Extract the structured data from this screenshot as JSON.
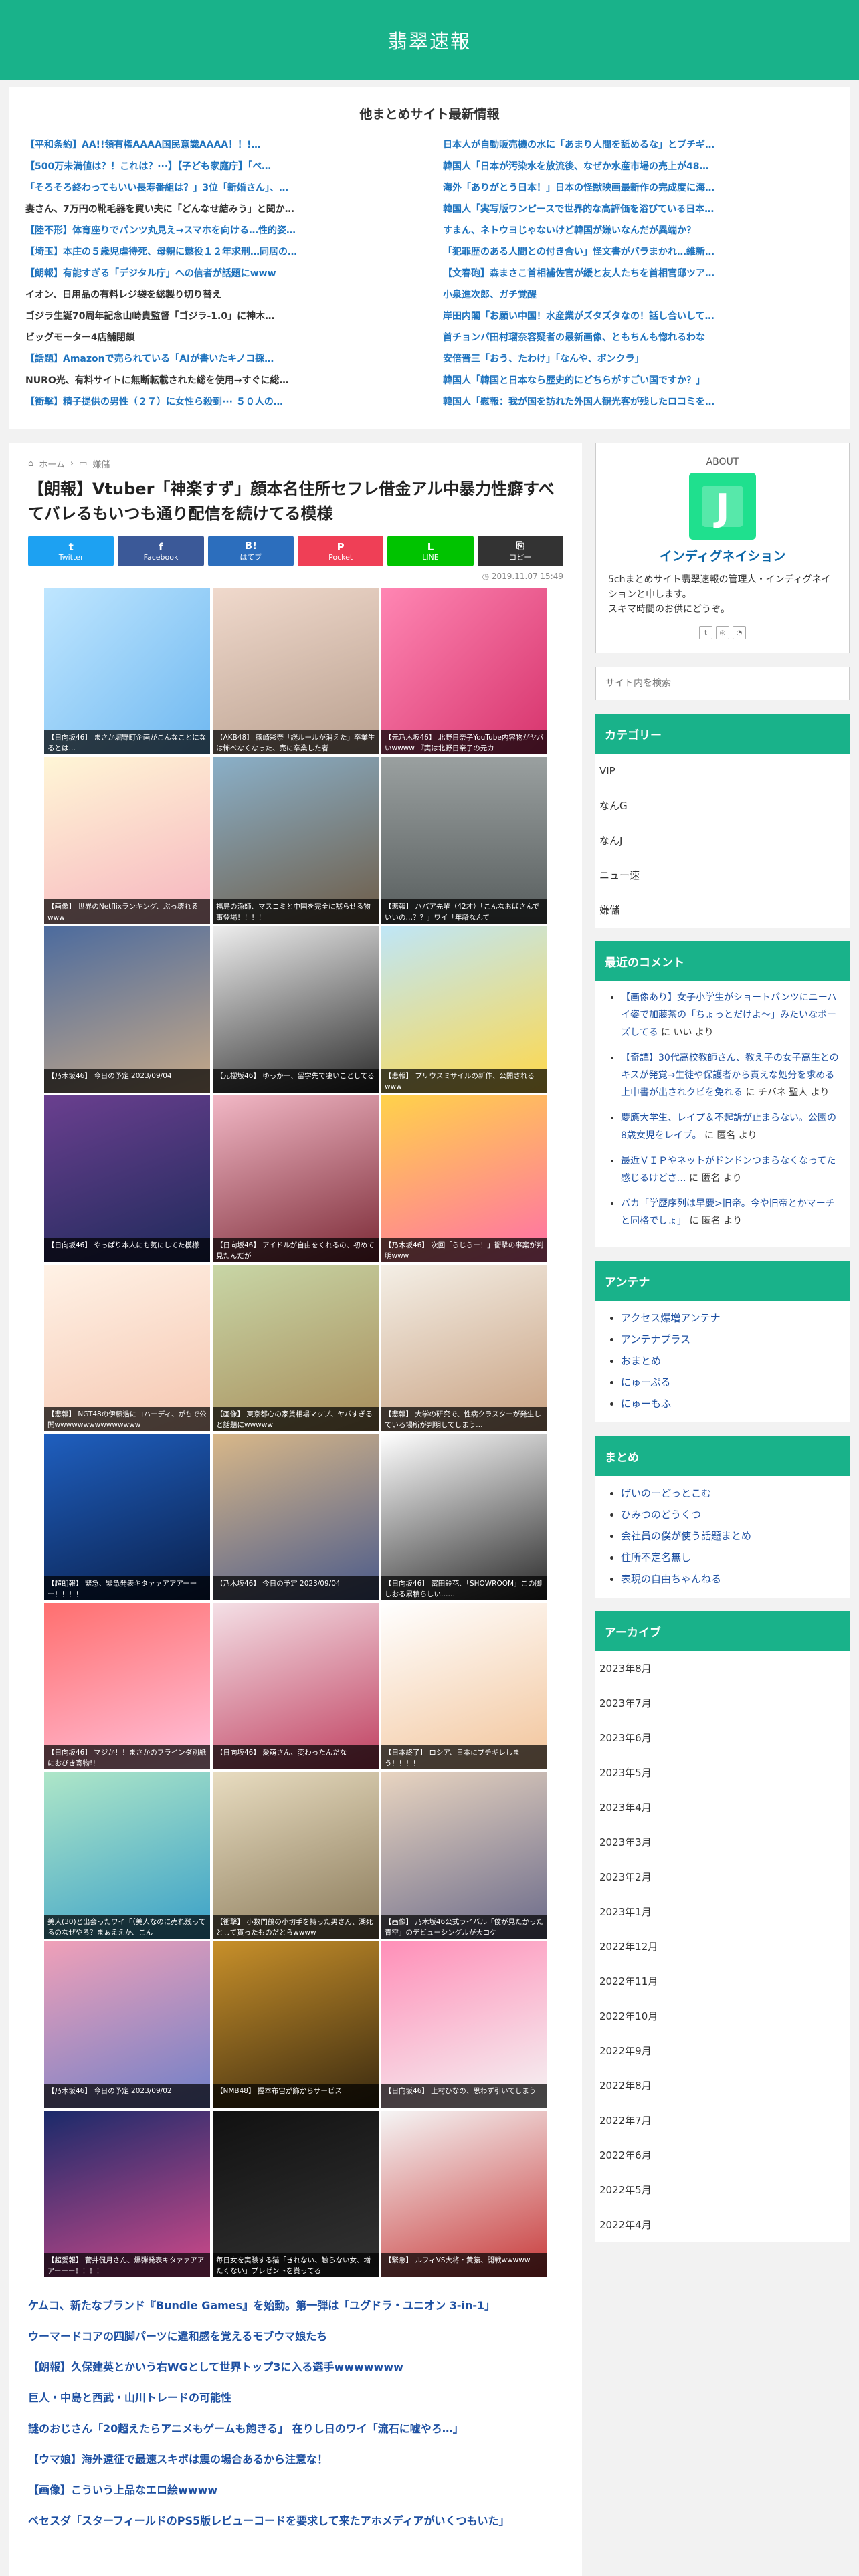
{
  "site": {
    "title": "翡翠速報"
  },
  "other_sites": {
    "title": "他まとめサイト最新情報",
    "left": [
      {
        "text": "【平和条約】AA!!領有権AAAA国民意識AAAA！！!…",
        "color": "#1e73be"
      },
      {
        "text": "【500万未満値は？！これは？···】【子ども家庭庁】「ベ…",
        "color": "#1e73be"
      },
      {
        "text": "「そろそろ終わってもいい長寿番組は？」3位「新婚さん」、…",
        "color": "#1e73be"
      },
      {
        "text": "妻さん、7万円の靴毛器を買い夫に「どんなせ結みう」と聞か…",
        "color": "#333333"
      },
      {
        "text": "【陸不形】体育座りでパンツ丸見え→スマホを向ける…性的姿…",
        "color": "#1e73be"
      },
      {
        "text": "【埼玉】本庄の５歳児虐待死、母親に懲役１２年求刑…同居の…",
        "color": "#1e73be"
      },
      {
        "text": "【朗報】有能すぎる「デジタル庁」への信者が話題にwww",
        "color": "#1e73be"
      },
      {
        "text": "イオン、日用品の有料レジ袋を総製り切り替え",
        "color": "#333333"
      },
      {
        "text": "ゴジラ生誕70周年記念山崎貴監督「ゴジラ-1.0」に神木…",
        "color": "#333333"
      },
      {
        "text": "ビッグモーター4店舗閉鎖",
        "color": "#333333"
      },
      {
        "text": "【話題】Amazonで売られている「AIが書いたキノコ採…",
        "color": "#1e73be"
      },
      {
        "text": "NURO光、有料サイトに無断転載された総を使用→すぐに総…",
        "color": "#333333"
      },
      {
        "text": "【衝撃】精子提供の男性（２７）に女性ら殺到··· ５０人の…",
        "color": "#1e73be"
      }
    ],
    "right": [
      {
        "text": "日本人が自動販売機の水に「あまり人間を舐めるな」とブチギ…",
        "color": "#1e73be"
      },
      {
        "text": "韓国人「日本が汚染水を放流後、なぜか水産市場の売上が48…",
        "color": "#1e73be"
      },
      {
        "text": "海外「ありがとう日本！」日本の怪獣映画最新作の完成度に海…",
        "color": "#1e73be"
      },
      {
        "text": "韓国人「実写版ワンピースで世界的な高評価を浴びている日本…",
        "color": "#1e73be"
      },
      {
        "text": "すまん、ネトウヨじゃないけど韓国が嫌いなんだが異端か？",
        "color": "#1e73be"
      },
      {
        "text": "「犯罪歴のある人間との付き合い」怪文書がバラまかれ…維新…",
        "color": "#1e73be"
      },
      {
        "text": "【文春砲】森まさこ首相補佐官が緩と友人たちを首相官邸ツア…",
        "color": "#1e73be"
      },
      {
        "text": "小泉進次郎、ガチ覚醒",
        "color": "#1e73be"
      },
      {
        "text": "岸田内閣「お願い中国！水産業がズタズタなの！話し合いして…",
        "color": "#1e73be"
      },
      {
        "text": "首チョンパ田村瑠奈容疑者の最新画像、ともちんも惚れるわな",
        "color": "#1e73be"
      },
      {
        "text": "安倍晋三「おう、たわけ」「なんや、ボンクラ」",
        "color": "#1e73be"
      },
      {
        "text": "韓国人「韓国と日本なら歴史的にどちらがすごい国ですか？」",
        "color": "#1e73be"
      },
      {
        "text": "韓国人「慰報：我が国を訪れた外国人観光客が残したロコミを…",
        "color": "#1e73be"
      }
    ]
  },
  "breadcrumb": {
    "home": "ホーム",
    "category": "嫌儲"
  },
  "post": {
    "title": "【朗報】Vtuber「神楽すず」顔本名住所セフレ借金アル中暴力性癖すべてバレるもいつも通り配信を続けてる模様",
    "date": "2019.11.07 15:49"
  },
  "share": [
    {
      "label": "Twitter",
      "icon": "t",
      "color": "#1da1f2"
    },
    {
      "label": "Facebook",
      "icon": "f",
      "color": "#3b5998"
    },
    {
      "label": "はてブ",
      "icon": "B!",
      "color": "#2c6ebd"
    },
    {
      "label": "Pocket",
      "icon": "P",
      "color": "#ef3f56"
    },
    {
      "label": "LINE",
      "icon": "L",
      "color": "#00c300"
    },
    {
      "label": "コピー",
      "icon": "⎘",
      "color": "#333333"
    }
  ],
  "thumbs": [
    {
      "caption": "【日向坂46】 まさか堀野町企画がこんなことになるとは…",
      "bg": "linear-gradient(135deg,#bfe6ff,#6fb8f0)"
    },
    {
      "caption": "【AKB48】 篠崎彩奈「謎ルールが消えた」卒業生は怖べなくなった、売に卒業した者",
      "bg": "linear-gradient(160deg,#f0d9cc,#b9a08f)"
    },
    {
      "caption": "【元乃木坂46】 北野日奈子YouTube内容物がヤバいwwww 『実は北野日奈子の元カ",
      "bg": "linear-gradient(135deg,#ff86b3,#d6336c)"
    },
    {
      "caption": "【画像】 世界のNetflixランキング、ぶっ壊れるwww",
      "bg": "linear-gradient(160deg,#fff6d6,#f6b4bf)"
    },
    {
      "caption": "福島の漁師、マスコミと中国を完全に黙らせる物事登場！！！！",
      "bg": "linear-gradient(160deg,#8ab0c9,#6e5c47)"
    },
    {
      "caption": "【悲報】 ハバア先輩（42才）「こんなおばさんでいいの…？？」ワイ「年齢なんて",
      "bg": "linear-gradient(180deg,#9aa0a0,#575d5d)"
    },
    {
      "caption": "【乃木坂46】 今日の予定 2023/09/04",
      "bg": "linear-gradient(160deg,#4c6b9e,#c7a987)"
    },
    {
      "caption": "【元櫻坂46】 ゆっかー、留学先で凄いことしてる",
      "bg": "linear-gradient(160deg,#eeeeee,#2b2b2b)"
    },
    {
      "caption": "【悲報】 プリウスミサイルの新作、公開されるwww",
      "bg": "linear-gradient(160deg,#bfe6f7,#ffd84a)"
    },
    {
      "caption": "【日向坂46】 やっぱり本人にも気にしてた模様",
      "bg": "linear-gradient(160deg,#6a3f8f,#1e2a5a)"
    },
    {
      "caption": "【日向坂46】 アイドルが自由をくれるの、初めて見たんだが",
      "bg": "linear-gradient(160deg,#f2b8c6,#7b2a36)"
    },
    {
      "caption": "【乃木坂46】 次回「らじらー！」衝撃の事案が判明www",
      "bg": "linear-gradient(160deg,#ffd24a,#ff6fa8)"
    },
    {
      "caption": "【悲報】 NGT48の伊藤浩にコハーディ、がちで公開wwwwwwwwwwwwwww",
      "bg": "linear-gradient(160deg,#fff2e6,#f5c6b0)"
    },
    {
      "caption": "【画像】 東京都心の家賃相場マップ、ヤバすぎると話題にwwwww",
      "bg": "linear-gradient(160deg,#c8d6a6,#a88c5a)"
    },
    {
      "caption": "【悲報】 大学の研究で、性病クラスターが発生している場所が判明してしまう…",
      "bg": "linear-gradient(160deg,#f4efe6,#c8a080)"
    },
    {
      "caption": "【超朗報】 緊急、緊急発表キタァァアアアーーー！！！！",
      "bg": "linear-gradient(160deg,#1f5fbf,#0a1f4a)"
    },
    {
      "caption": "【乃木坂46】 今日の予定 2023/09/04",
      "bg": "linear-gradient(160deg,#d9b889,#4a5a8a)"
    },
    {
      "caption": "【日向坂46】 富田鈴花、「SHOWROOM」この脚しおる累積らしい……",
      "bg": "linear-gradient(160deg,#ffffff,#2a2a2a)"
    },
    {
      "caption": "【日向坂46】 マジか！！まさかのフラインダ別紙におびき寄物!！",
      "bg": "linear-gradient(160deg,#ff6f6f,#ffc2dc)"
    },
    {
      "caption": "【日向坂46】 愛萌さん、変わったんだな",
      "bg": "linear-gradient(160deg,#f4e0e6,#c04060)"
    },
    {
      "caption": "【日本終了】 ロシア、日本にブチギレしまう！！！！",
      "bg": "linear-gradient(160deg,#ffffff,#f2c49a)"
    },
    {
      "caption": "美人(30)と出会ったワイ「（美人なのに売れ残ってるのなぜやろ？まぁええか、こん",
      "bg": "linear-gradient(160deg,#aee6c8,#3aa0c8)"
    },
    {
      "caption": "【衝撃】 小数門鶴の小切手を持った男さん、湖死として貰ったものだとらwwww",
      "bg": "linear-gradient(160deg,#e8dcc0,#8a7a5a)"
    },
    {
      "caption": "【画像】 乃木坂46公式ライバル「僕が見たかった青空」のデビューシングルが大コケ",
      "bg": "linear-gradient(160deg,#e8d4c0,#6a6a8a)"
    },
    {
      "caption": "【乃木坂46】 今日の予定 2023/09/02",
      "bg": "linear-gradient(160deg,#f0a0b8,#7080c8)"
    },
    {
      "caption": "【NMB48】 握本布宙が飾からサービス",
      "bg": "linear-gradient(160deg,#c8902a,#3a2a10)"
    },
    {
      "caption": "【日向坂46】 上村ひなの、思わず引いてしまう",
      "bg": "linear-gradient(160deg,#ff8fb8,#f4f4f4)"
    },
    {
      "caption": "【超愛報】 菅井侃月さん、爆弾発表キタァァアアアーーー！！！！",
      "bg": "linear-gradient(160deg,#1a2a6a,#d04a8a)"
    },
    {
      "caption": "毎日女を実験する猫「きれない、触らない女、増たくない」プレゼントを貰ってる",
      "bg": "linear-gradient(160deg,#111111,#333333)"
    },
    {
      "caption": "【緊急】 ルフィVS大将・黄猿、開戦wwwww",
      "bg": "linear-gradient(160deg,#f5f5f5,#c83a3a)"
    }
  ],
  "related": [
    "ケムコ、新たなブランド『Bundle Games』を始動。第一弾は「ユグドラ・ユニオン 3-in-1」",
    "ウーマードコアの四脚パーツに違和感を覚えるモブウマ娘たち",
    "【朗報】久保建英とかいう右WGとして世界トップ3に入る選手wwwwwww",
    "巨人・中島と西武・山川トレードの可能性",
    "謎のおじさん「20超えたらアニメもゲームも飽きる」 在りし日のワイ「流石に嘘やろ…」",
    "【ウマ娘】海外遠征で最速スキボは震の場合あるから注意な！",
    "【画像】こういう上品なエロ絵wwww",
    "ベセスダ「スターフィールドのPS5版レビューコードを要求して来たアホメディアがいくつもいた」"
  ],
  "sidebar": {
    "about": {
      "heading": "ABOUT",
      "logo_letter": "J",
      "name": "インディグネイション",
      "desc": "5chまとめサイト翡翠速報の管理人・インディグネイションと申します。\nスキマ時間のお供にどうぞ。"
    },
    "search_placeholder": "サイト内を検索",
    "category_title": "カテゴリー",
    "categories": [
      "VIP",
      "なんG",
      "なんJ",
      "ニュー速",
      "嫌儲"
    ],
    "comments_title": "最近のコメント",
    "comments": [
      {
        "link": "【画像あり】女子小学生がショートパンツにニーハイ姿で加藤茶の「ちょっとだけよ〜」みたいなポーズしてる",
        "suffix": " に いい より"
      },
      {
        "link": "【奇譚】30代高校教師さん、教え子の女子高生とのキスが発覚→生徒や保護者から責えな処分を求める上申書が出されクビを免れる",
        "suffix": " に チバネ 聖人 より"
      },
      {
        "link": "慶應大学生、レイプ＆不起訴が止まらない。公園の8歳女児をレイプ。",
        "suffix": " に 匿名 より"
      },
      {
        "link": "最近ＶＩＰやネットがドンドンつまらなくなってた感じるけどさ…",
        "suffix": " に 匿名 より"
      },
      {
        "link": "バカ「学歴序列は早慶>旧帝。今や旧帝とかマーチと同格でしょ」",
        "suffix": " に 匿名 より"
      }
    ],
    "antenna_title": "アンテナ",
    "antenna": [
      "アクセス爆増アンテナ",
      "アンテナプラス",
      "おまとめ",
      "にゅーぷる",
      "にゅーもふ"
    ],
    "matome_title": "まとめ",
    "matome": [
      "げいのーどっとこむ",
      "ひみつのどうくつ",
      "会社員の僕が使う話題まとめ",
      "住所不定名無し",
      "表現の自由ちゃんねる"
    ],
    "archive_title": "アーカイブ",
    "archives": [
      "2023年8月",
      "2023年7月",
      "2023年6月",
      "2023年5月",
      "2023年4月",
      "2023年3月",
      "2023年2月",
      "2023年1月",
      "2022年12月",
      "2022年11月",
      "2022年10月",
      "2022年9月",
      "2022年8月",
      "2022年7月",
      "2022年6月",
      "2022年5月",
      "2022年4月"
    ]
  }
}
